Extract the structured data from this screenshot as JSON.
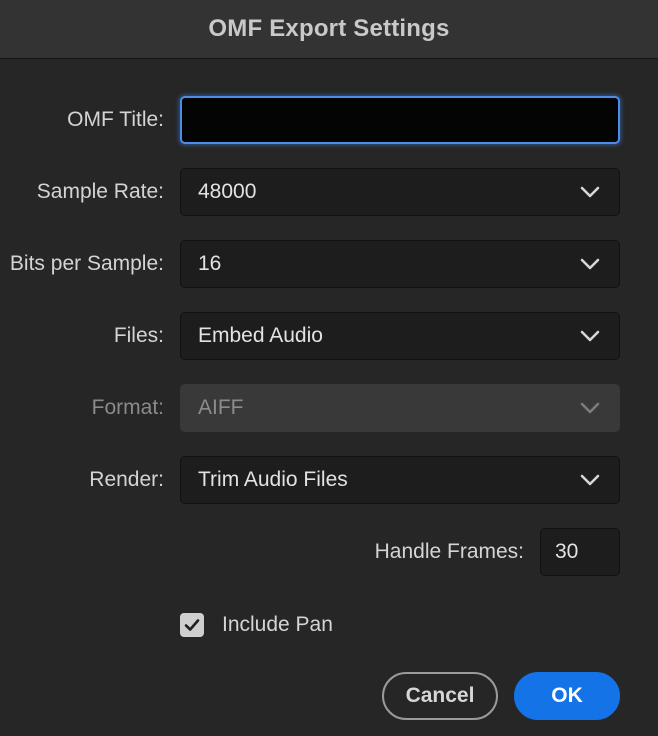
{
  "dialog": {
    "title": "OMF Export Settings"
  },
  "fields": {
    "omf_title": {
      "label": "OMF Title:",
      "value": ""
    },
    "sample_rate": {
      "label": "Sample Rate:",
      "value": "48000"
    },
    "bits_per_sample": {
      "label": "Bits per Sample:",
      "value": "16"
    },
    "files": {
      "label": "Files:",
      "value": "Embed Audio"
    },
    "format": {
      "label": "Format:",
      "value": "AIFF",
      "disabled": true
    },
    "render": {
      "label": "Render:",
      "value": "Trim Audio Files"
    },
    "handle_frames": {
      "label": "Handle Frames:",
      "value": "30"
    },
    "include_pan": {
      "label": "Include Pan",
      "checked": true
    }
  },
  "buttons": {
    "cancel_label": "Cancel",
    "ok_label": "OK"
  },
  "icons": {
    "dropdown": "chevron-down-icon",
    "checkbox": "checkmark-icon"
  },
  "colors": {
    "accent": "#1473e6",
    "focus_ring": "#4a8ee8",
    "background": "#262626",
    "titlebar": "#333333"
  }
}
